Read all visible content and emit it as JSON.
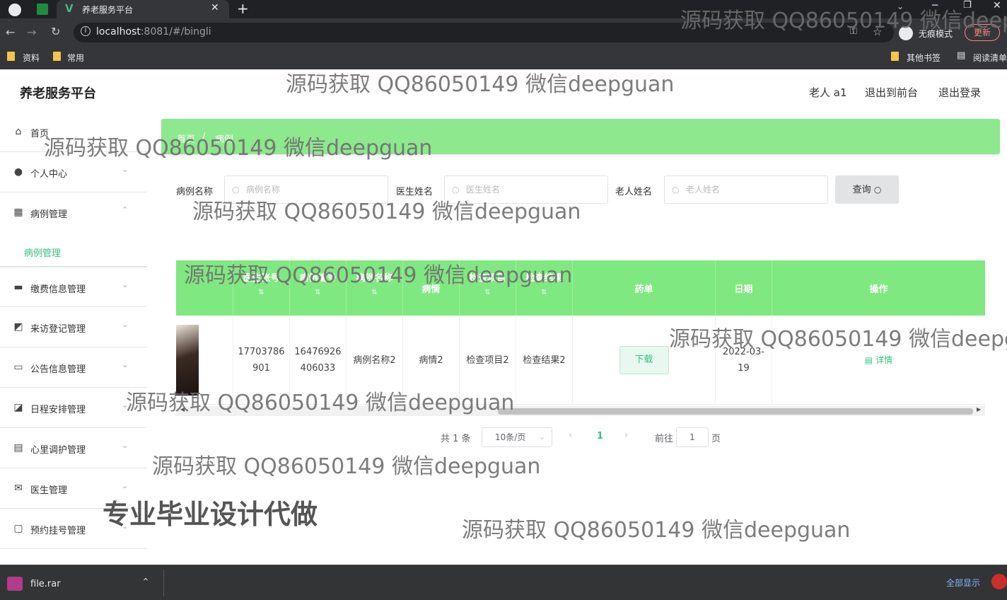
{
  "browser": {
    "tab_title": "养老服务平台",
    "url_host": "localhost",
    "url_port_path": ":8081/#/bingli",
    "incognito_label": "无痕模式",
    "update_label": "更新",
    "bookmarks": [
      "资料",
      "常用"
    ],
    "bookmarks_right": [
      "其他书签",
      "阅读清单"
    ],
    "download_file": "file.rar",
    "show_all_label": "全部显示"
  },
  "app": {
    "brand": "养老服务平台",
    "topnav": [
      "老人 a1",
      "退出到前台",
      "退出登录"
    ]
  },
  "sidebar": {
    "items": [
      {
        "label": "首页",
        "icon": "home-icon"
      },
      {
        "label": "个人中心",
        "icon": "user-icon"
      },
      {
        "label": "病例管理",
        "icon": "grid-icon"
      },
      {
        "label": "缴费信息管理",
        "icon": "card-icon"
      },
      {
        "label": "来访登记管理",
        "icon": "chart-icon"
      },
      {
        "label": "公告信息管理",
        "icon": "briefcase-icon"
      },
      {
        "label": "日程安排管理",
        "icon": "wallet-icon"
      },
      {
        "label": "心里调护管理",
        "icon": "doc-icon"
      },
      {
        "label": "医生管理",
        "icon": "mail-icon"
      },
      {
        "label": "预约挂号管理",
        "icon": "chat-icon"
      }
    ],
    "sub_item": "病例管理"
  },
  "breadcrumb": [
    "首页",
    "病例"
  ],
  "search": {
    "fields": [
      {
        "label": "病例名称",
        "placeholder": "病例名称"
      },
      {
        "label": "医生姓名",
        "placeholder": "医生姓名"
      },
      {
        "label": "老人姓名",
        "placeholder": "老人姓名"
      }
    ],
    "query_label": "查询"
  },
  "table": {
    "headers": [
      "",
      "医生账号",
      "病例编号",
      "病例名称",
      "病情",
      "检查项目",
      "检查结果",
      "药单",
      "日期",
      "操作"
    ],
    "row": {
      "doctor_account": "17703786901",
      "case_no": "16476926406033",
      "case_name": "病例名称2",
      "condition": "病情2",
      "check_item": "检查项目2",
      "check_result": "检查结果2",
      "download_label": "下载",
      "date": "2022-03-19",
      "detail_label": "详情"
    }
  },
  "pager": {
    "total": "共 1 条",
    "page_size": "10条/页",
    "current": "1",
    "goto_label": "前往",
    "goto_value": "1",
    "page_unit": "页"
  },
  "watermarks": {
    "text": "源码获取 QQ86050149 微信deepguan",
    "big": "专业毕业设计代做"
  },
  "colors": {
    "accent": "#38c27e",
    "header_green": "#80e880",
    "breadcrumb_green": "#8ee88e"
  }
}
